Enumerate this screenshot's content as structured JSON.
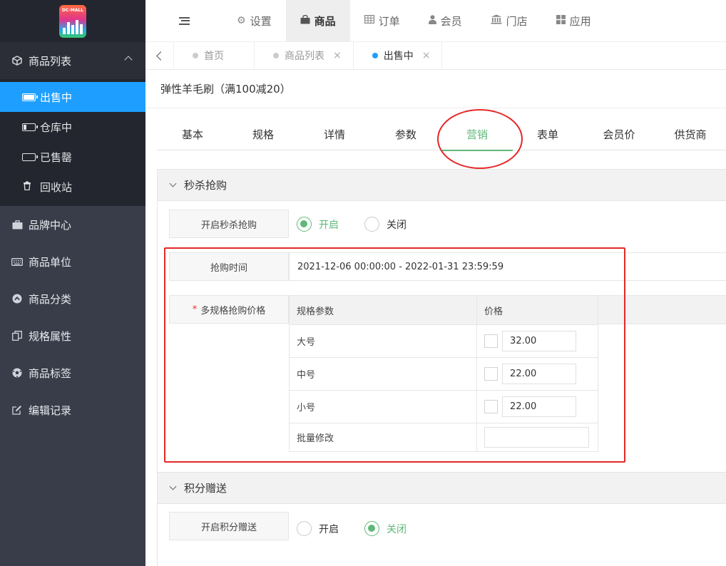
{
  "logo": {
    "text": "DC-MALL"
  },
  "sidebar": {
    "group_label": "商品列表",
    "sub_items": [
      {
        "label": "出售中",
        "icon": "battery-full-icon",
        "active": true
      },
      {
        "label": "仓库中",
        "icon": "battery-low-icon",
        "active": false
      },
      {
        "label": "已售罄",
        "icon": "battery-empty-icon",
        "active": false
      },
      {
        "label": "回收站",
        "icon": "trash-icon",
        "active": false
      }
    ],
    "items": [
      {
        "label": "品牌中心",
        "icon": "briefcase-icon"
      },
      {
        "label": "商品单位",
        "icon": "keyboard-icon"
      },
      {
        "label": "商品分类",
        "icon": "circle-up-icon"
      },
      {
        "label": "规格属性",
        "icon": "copy-icon"
      },
      {
        "label": "商品标签",
        "icon": "soccer-ball-icon"
      },
      {
        "label": "编辑记录",
        "icon": "edit-icon"
      }
    ]
  },
  "topnav": {
    "items": [
      {
        "label": "设置",
        "icon": "gears-icon",
        "glyph": "⚙",
        "active": false
      },
      {
        "label": "商品",
        "icon": "shopping-bag-icon",
        "glyph": "👜",
        "active": true
      },
      {
        "label": "订单",
        "icon": "table-icon",
        "glyph": "▦",
        "active": false
      },
      {
        "label": "会员",
        "icon": "user-icon",
        "glyph": "👤",
        "active": false
      },
      {
        "label": "门店",
        "icon": "bank-icon",
        "glyph": "🏛",
        "active": false
      },
      {
        "label": "应用",
        "icon": "grid-icon",
        "glyph": "▩",
        "active": false
      }
    ]
  },
  "pagetabs": {
    "items": [
      {
        "label": "首页",
        "closable": false,
        "active": false
      },
      {
        "label": "商品列表",
        "closable": true,
        "active": false
      },
      {
        "label": "出售中",
        "closable": true,
        "active": true
      }
    ],
    "close_glyph": "×"
  },
  "product": {
    "title": "弹性羊毛刷（满100减20）"
  },
  "section_tabs": [
    "基本",
    "规格",
    "详情",
    "参数",
    "营销",
    "表单",
    "会员价",
    "供货商"
  ],
  "active_section_tab": "营销",
  "flash_sale": {
    "panel_title": "秒杀抢购",
    "enable_label": "开启秒杀抢购",
    "on_label": "开启",
    "off_label": "关闭",
    "selected": "on",
    "time_label": "抢购时间",
    "time_range": "2021-12-06 00:00:00 - 2022-01-31 23:59:59",
    "required_mark": "*",
    "spec_price_label": "多规格抢购价格",
    "table": {
      "headers": [
        "规格参数",
        "价格"
      ],
      "rows": [
        {
          "spec": "大号",
          "price": "32.00"
        },
        {
          "spec": "中号",
          "price": "22.00"
        },
        {
          "spec": "小号",
          "price": "22.00"
        }
      ],
      "batch_label": "批量修改",
      "batch_value": ""
    }
  },
  "points_gift": {
    "panel_title": "积分赠送",
    "enable_label": "开启积分赠送",
    "on_label": "开启",
    "off_label": "关闭",
    "selected": "off"
  },
  "colors": {
    "sidebar_bg": "#393d49",
    "active_blue": "#1e9fff",
    "accent_green": "#5fb878",
    "annotation_red": "#e52828"
  }
}
